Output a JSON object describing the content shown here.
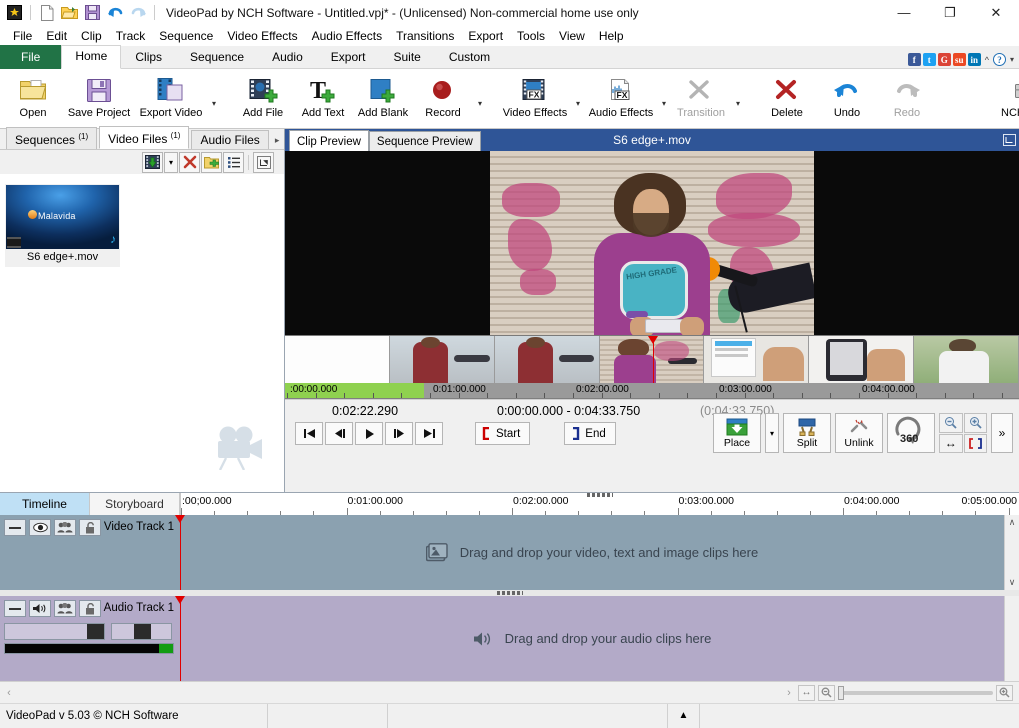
{
  "window": {
    "title": "VideoPad by NCH Software - Untitled.vpj* - (Unlicensed) Non-commercial home use only",
    "minimize": "—",
    "maximize": "❐",
    "close": "✕"
  },
  "quick_access": [
    {
      "name": "app-icon",
      "label": "★"
    },
    {
      "name": "new-project-icon",
      "label": "□"
    },
    {
      "name": "open-project-icon",
      "label": "▤"
    },
    {
      "name": "save-project-icon",
      "label": "▥"
    },
    {
      "name": "undo-icon",
      "label": "↶"
    },
    {
      "name": "redo-icon",
      "label": "↷"
    }
  ],
  "menu": [
    "File",
    "Edit",
    "Clip",
    "Track",
    "Sequence",
    "Video Effects",
    "Audio Effects",
    "Transitions",
    "Export",
    "Tools",
    "View",
    "Help"
  ],
  "ribbon": {
    "tabs": [
      {
        "label": "File",
        "active": false,
        "file": true
      },
      {
        "label": "Home",
        "active": true
      },
      {
        "label": "Clips",
        "active": false
      },
      {
        "label": "Sequence",
        "active": false
      },
      {
        "label": "Audio",
        "active": false
      },
      {
        "label": "Export",
        "active": false
      },
      {
        "label": "Suite",
        "active": false
      },
      {
        "label": "Custom",
        "active": false
      }
    ],
    "social": [
      {
        "name": "facebook-icon",
        "label": "f",
        "color": "#3b5998"
      },
      {
        "name": "twitter-icon",
        "label": "t",
        "color": "#1da1f2"
      },
      {
        "name": "googleplus-icon",
        "label": "G",
        "color": "#db4437"
      },
      {
        "name": "stumbleupon-icon",
        "label": "su",
        "color": "#eb4924"
      },
      {
        "name": "linkedin-icon",
        "label": "in",
        "color": "#0077b5"
      }
    ],
    "social_chevron": "^",
    "help_icon": "?",
    "help_caret": "▾",
    "buttons": [
      {
        "name": "open",
        "label": "Open",
        "disabled": false
      },
      {
        "name": "save-project",
        "label": "Save Project",
        "disabled": false
      },
      {
        "name": "export-video",
        "label": "Export Video",
        "disabled": false,
        "caret": true
      },
      {
        "name": "add-file",
        "label": "Add File",
        "disabled": false
      },
      {
        "name": "add-text",
        "label": "Add Text",
        "disabled": false
      },
      {
        "name": "add-blank",
        "label": "Add Blank",
        "disabled": false
      },
      {
        "name": "record",
        "label": "Record",
        "disabled": false,
        "caret": true
      },
      {
        "name": "video-effects",
        "label": "Video Effects",
        "disabled": false,
        "caret": true
      },
      {
        "name": "audio-effects",
        "label": "Audio Effects",
        "disabled": false,
        "caret": true
      },
      {
        "name": "transition",
        "label": "Transition",
        "disabled": true,
        "caret": true
      },
      {
        "name": "delete",
        "label": "Delete",
        "disabled": false
      },
      {
        "name": "undo",
        "label": "Undo",
        "disabled": false
      },
      {
        "name": "redo",
        "label": "Redo",
        "disabled": true
      },
      {
        "name": "nch-suite",
        "label": "NCH Suite",
        "disabled": false
      }
    ],
    "overflow": "»"
  },
  "bin": {
    "tabs": [
      {
        "label": "Sequences",
        "count": "(1)",
        "active": false
      },
      {
        "label": "Video Files",
        "count": "(1)",
        "active": true
      },
      {
        "label": "Audio Files",
        "count": "",
        "active": false
      }
    ],
    "tab_scroll": "▸",
    "toolbar": [
      {
        "name": "add-files-button",
        "label": "add-file-icon"
      },
      {
        "name": "add-files-dropdown",
        "label": "▾"
      },
      {
        "name": "remove-file-button",
        "label": "✕"
      },
      {
        "name": "add-folder-button",
        "label": "add-folder-icon"
      },
      {
        "name": "list-view-button",
        "label": "list-icon"
      },
      {
        "name": "detach-panel-button",
        "label": "detach-icon"
      }
    ],
    "file": {
      "name": "S6 edge+.mov",
      "thumb_label": "Malavida"
    }
  },
  "preview": {
    "tabs": [
      {
        "label": "Clip Preview",
        "active": true
      },
      {
        "label": "Sequence Preview",
        "active": false
      }
    ],
    "title": "S6 edge+.mov",
    "detach_icon": "detach-icon",
    "strip_labels": [
      ":00:00.000",
      "0:01:00.000",
      "0:02:00.000",
      "0:03:00.000",
      "0:04:00.000"
    ],
    "transport": {
      "current_time": "0:02:22.290",
      "range": "0:00:00.000 - 0:04:33.750",
      "total": "(0:04:33.750)",
      "buttons": [
        {
          "name": "jump-to-start-button",
          "label": "⏮"
        },
        {
          "name": "step-back-button",
          "label": "◀|"
        },
        {
          "name": "play-button",
          "label": "▶"
        },
        {
          "name": "step-forward-button",
          "label": "|▶"
        },
        {
          "name": "jump-to-end-button",
          "label": "⏭"
        }
      ],
      "start_label": "Start",
      "end_label": "End",
      "place_label": "Place",
      "place_caret": "▾",
      "split_label": "Split",
      "unlink_label": "Unlink",
      "spin_label": "360",
      "zoom_out_label": "zoom-out-icon",
      "zoom_in_label": "zoom-in-icon",
      "fit_width_label": "↔",
      "fit_selection_label": "[ ]",
      "more_label": "»"
    }
  },
  "timeline": {
    "tabs": [
      {
        "label": "Timeline",
        "active": true
      },
      {
        "label": "Storyboard",
        "active": false
      }
    ],
    "ruler_labels": [
      ":00;00.000",
      "0:01:00.000",
      "0:02:00.000",
      "0:03:00.000",
      "0:04:00.000",
      "0:05:00.000"
    ],
    "video_track": {
      "name": "Video Track 1",
      "placeholder": "Drag and drop your video, text and image clips here",
      "controls": [
        {
          "name": "collapse-track-button",
          "label": "—"
        },
        {
          "name": "visibility-toggle-button",
          "label": "eye-icon"
        },
        {
          "name": "track-group-button",
          "label": "group-icon"
        },
        {
          "name": "lock-track-button",
          "label": "unlock-icon"
        }
      ]
    },
    "audio_track": {
      "name": "Audio Track 1",
      "placeholder": "Drag and drop your audio clips here",
      "controls": [
        {
          "name": "collapse-track-button",
          "label": "—"
        },
        {
          "name": "mute-toggle-button",
          "label": "speaker-icon"
        },
        {
          "name": "track-group-button",
          "label": "group-icon"
        },
        {
          "name": "lock-track-button",
          "label": "unlock-icon"
        }
      ]
    },
    "scroll_up": "∧",
    "scroll_down": "∨"
  },
  "bottom": {
    "scroll_left": "‹",
    "scroll_right": "›",
    "fit_icon": "↔",
    "zoom_out_icon": "zoom-out-icon",
    "zoom_in_icon": "zoom-in-icon"
  },
  "status": {
    "text": "VideoPad v 5.03 © NCH Software",
    "triangle": "▲"
  },
  "colors": {
    "file_tab_green": "#217346",
    "preview_header_blue": "#2f5597",
    "playhead_red": "#e00000",
    "timeline_tab_blue": "#bfe0f5",
    "video_track": "#8ba1b0",
    "audio_track": "#b3aac8",
    "selection_green": "#8fd14f"
  }
}
